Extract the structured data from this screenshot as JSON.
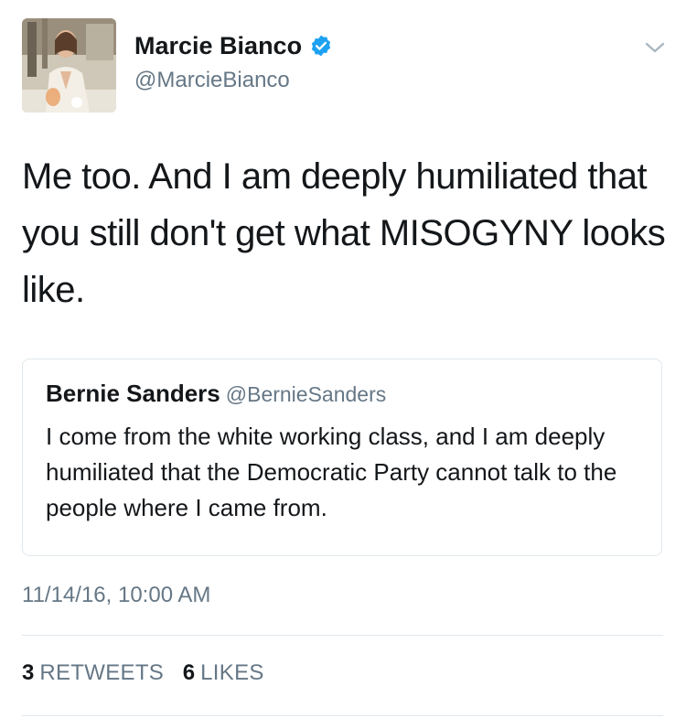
{
  "tweet": {
    "author_name": "Marcie Bianco",
    "author_handle": "@MarcieBianco",
    "text": "Me too. And I am deeply humiliated that you still don't get what MISOGYNY looks like.",
    "timestamp": "11/14/16, 10:00 AM",
    "retweets_count": "3",
    "retweets_label": "RETWEETS",
    "likes_count": "6",
    "likes_label": "LIKES"
  },
  "quoted_tweet": {
    "author_name": "Bernie Sanders",
    "author_handle": "@BernieSanders",
    "text": "I come from the white working class, and I am deeply humiliated that the Democratic Party cannot talk to the people where I came from."
  },
  "icons": {
    "verified": "verified-badge-icon",
    "menu": "chevron-down-icon"
  },
  "colors": {
    "verified_blue": "#1da1f2",
    "text_primary": "#14171a",
    "text_secondary": "#657786",
    "border": "#e1e8ed"
  }
}
